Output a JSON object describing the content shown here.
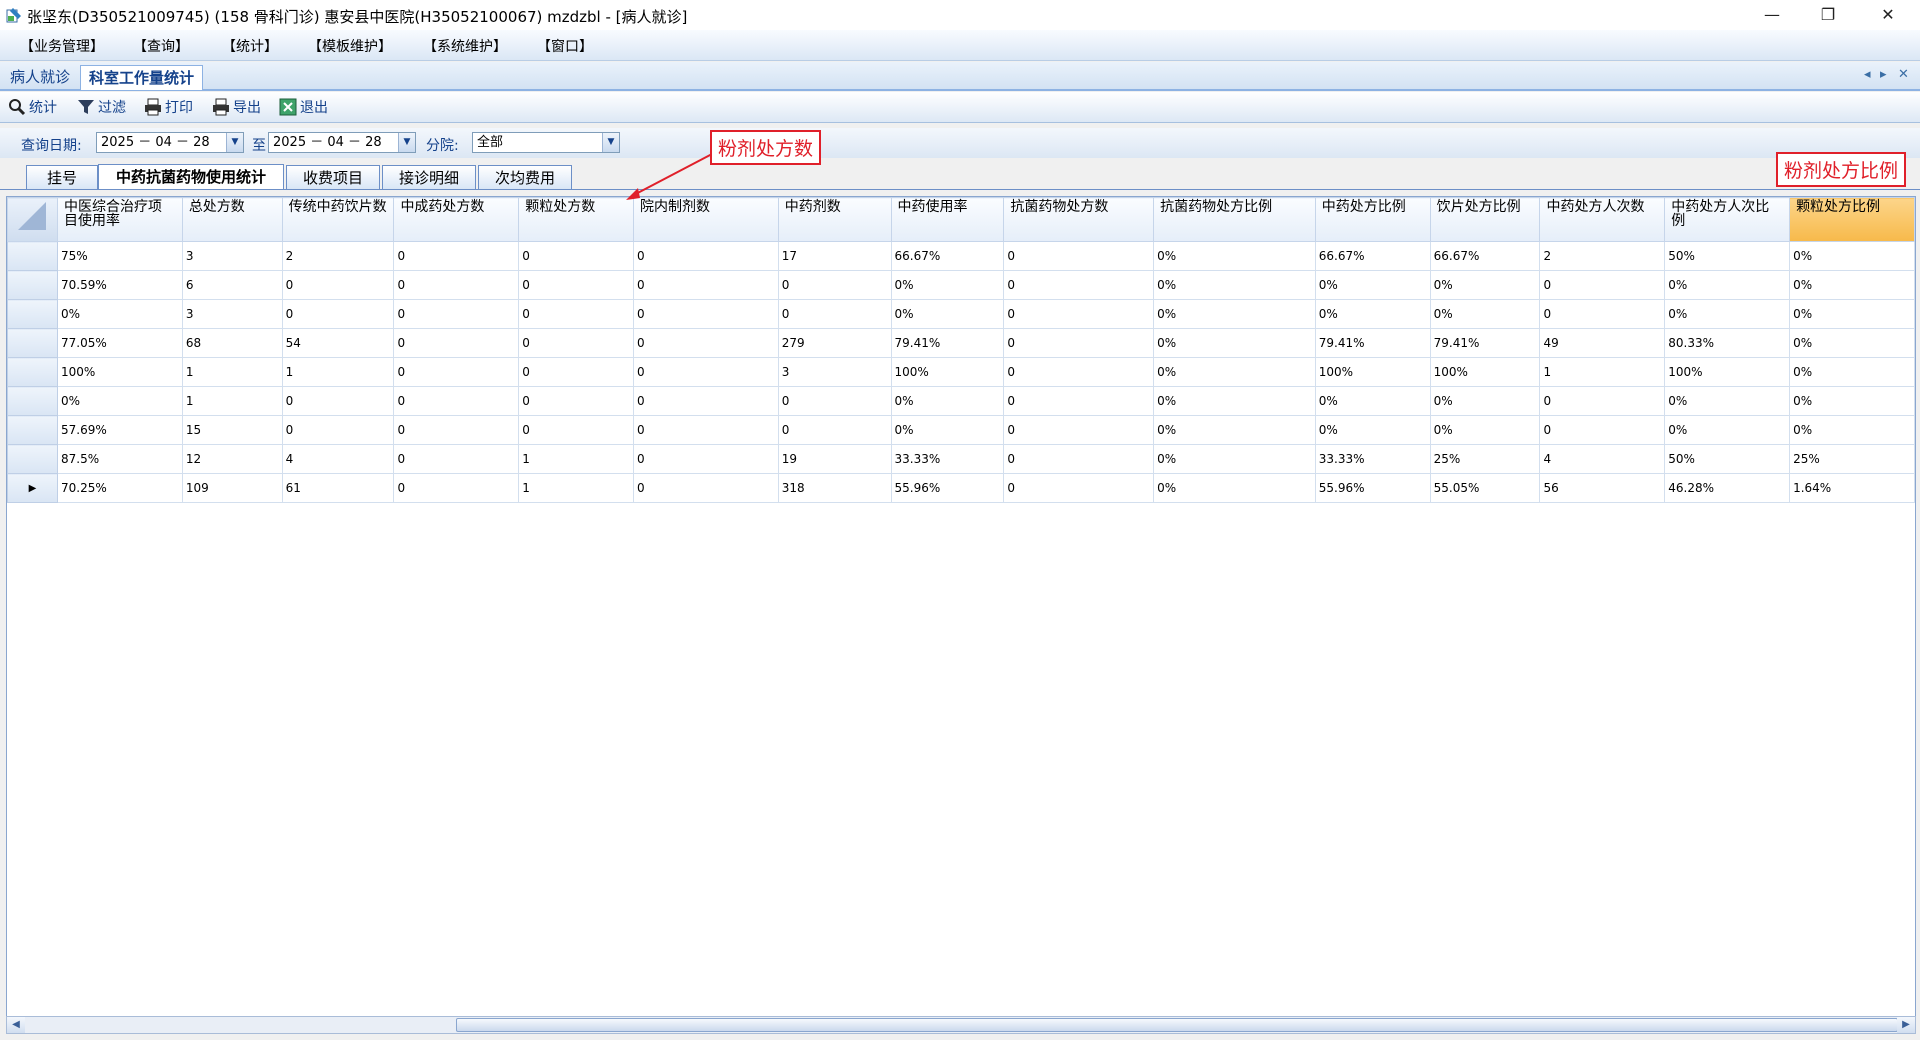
{
  "window": {
    "title": "张坚东(D350521009745) (158 骨科门诊) 惠安县中医院(H35052100067) mzdzbl - [病人就诊]",
    "controls": [
      "—",
      "❐",
      "✕"
    ]
  },
  "menu": [
    "【业务管理】",
    "【查询】",
    "【统计】",
    "【模板维护】",
    "【系统维护】",
    "【窗口】"
  ],
  "doc_tabs": [
    "病人就诊",
    "科室工作量统计"
  ],
  "tab_nav": [
    "◂",
    "▸",
    "✕"
  ],
  "toolbar": {
    "stats": "统计",
    "filter": "过滤",
    "print": "打印",
    "export": "导出",
    "exit": "退出"
  },
  "filter": {
    "date_label": "查询日期:",
    "date_from": "2025 － 04 － 28",
    "to_label": "至",
    "date_to": "2025 － 04 － 28",
    "branch_label": "分院:",
    "branch_value": "全部"
  },
  "sub_tabs": [
    "挂号",
    "中药抗菌药物使用统计",
    "收费项目",
    "接诊明细",
    "次均费用"
  ],
  "columns": [
    "中医综合治疗项目使用率",
    "总处方数",
    "传统中药饮片数",
    "中成药处方数",
    "颗粒处方数",
    "院内制剂数",
    "中药剂数",
    "中药使用率",
    "抗菌药物处方数",
    "抗菌药物处方比例",
    "中药处方比例",
    "饮片处方比例",
    "中药处方人次数",
    "中药处方人次比例",
    "颗粒处方比例"
  ],
  "rows": [
    [
      "75%",
      "3",
      "2",
      "0",
      "0",
      "0",
      "17",
      "66.67%",
      "0",
      "0%",
      "66.67%",
      "66.67%",
      "2",
      "50%",
      "0%"
    ],
    [
      "70.59%",
      "6",
      "0",
      "0",
      "0",
      "0",
      "0",
      "0%",
      "0",
      "0%",
      "0%",
      "0%",
      "0",
      "0%",
      "0%"
    ],
    [
      "0%",
      "3",
      "0",
      "0",
      "0",
      "0",
      "0",
      "0%",
      "0",
      "0%",
      "0%",
      "0%",
      "0",
      "0%",
      "0%"
    ],
    [
      "77.05%",
      "68",
      "54",
      "0",
      "0",
      "0",
      "279",
      "79.41%",
      "0",
      "0%",
      "79.41%",
      "79.41%",
      "49",
      "80.33%",
      "0%"
    ],
    [
      "100%",
      "1",
      "1",
      "0",
      "0",
      "0",
      "3",
      "100%",
      "0",
      "0%",
      "100%",
      "100%",
      "1",
      "100%",
      "0%"
    ],
    [
      "0%",
      "1",
      "0",
      "0",
      "0",
      "0",
      "0",
      "0%",
      "0",
      "0%",
      "0%",
      "0%",
      "0",
      "0%",
      "0%"
    ],
    [
      "57.69%",
      "15",
      "0",
      "0",
      "0",
      "0",
      "0",
      "0%",
      "0",
      "0%",
      "0%",
      "0%",
      "0",
      "0%",
      "0%"
    ],
    [
      "87.5%",
      "12",
      "4",
      "0",
      "1",
      "0",
      "19",
      "33.33%",
      "0",
      "0%",
      "33.33%",
      "25%",
      "4",
      "50%",
      "25%"
    ],
    [
      "70.25%",
      "109",
      "61",
      "0",
      "1",
      "0",
      "318",
      "55.96%",
      "0",
      "0%",
      "55.96%",
      "55.05%",
      "56",
      "46.28%",
      "1.64%"
    ]
  ],
  "current_row_marker": "▶",
  "annotations": {
    "powder_count": "粉剂处方数",
    "powder_ratio": "粉剂处方比例"
  },
  "colors": {
    "callout": "#e0202a",
    "highlight": "#f7b94a",
    "accent": "#15428b"
  }
}
